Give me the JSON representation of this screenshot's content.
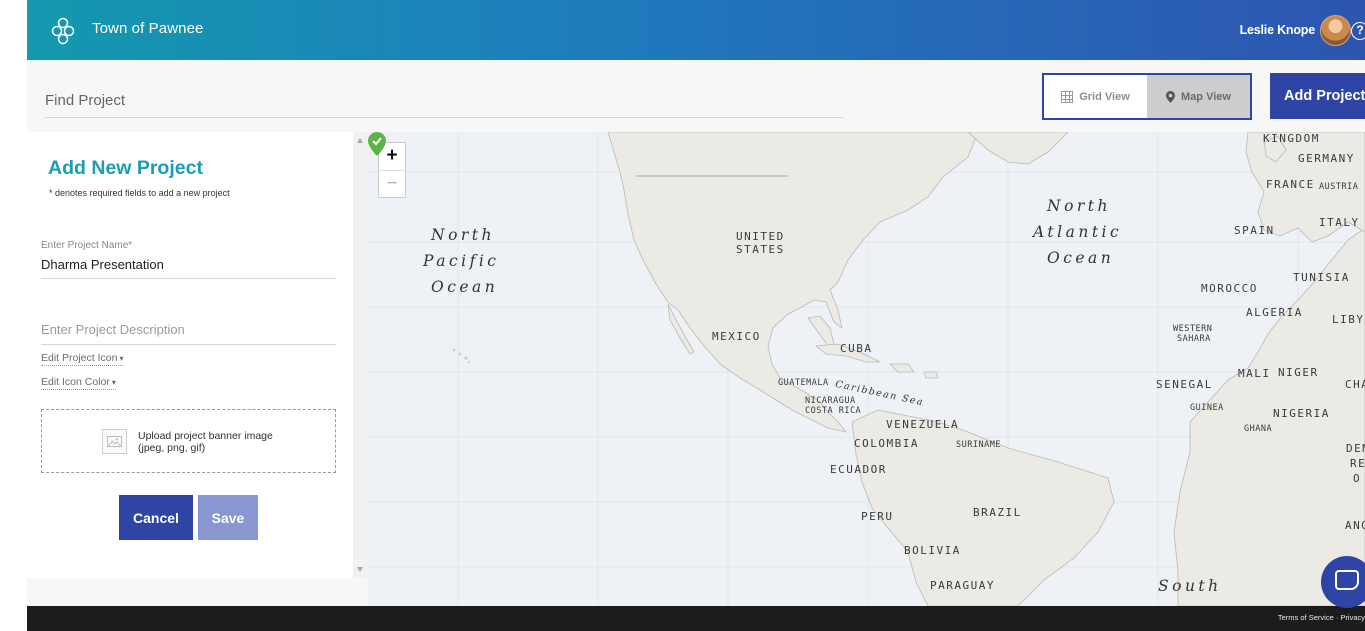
{
  "header": {
    "app_title": "Town of Pawnee",
    "user_name": "Leslie Knope",
    "help_symbol": "?"
  },
  "toolbar": {
    "search_placeholder": "Find Project",
    "grid_view_label": "Grid View",
    "map_view_label": "Map View",
    "active_view": "Map View",
    "add_project_label": "Add Project"
  },
  "panel": {
    "title": "Add New Project",
    "required_note": "* denotes required fields to add a new project",
    "name_label": "Enter Project Name*",
    "name_value": "Dharma Presentation",
    "description_placeholder": "Enter Project Description",
    "edit_icon_label": "Edit Project Icon",
    "edit_color_label": "Edit Icon Color",
    "upload_line1": "Upload project banner image",
    "upload_line2": "(jpeg, png, gif)",
    "cancel_label": "Cancel",
    "save_label": "Save"
  },
  "map": {
    "zoom_in": "+",
    "zoom_out": "−",
    "ocean_labels": {
      "north_pacific": [
        "North",
        "Pacific",
        "Ocean"
      ],
      "north_atlantic": [
        "North",
        "Atlantic",
        "Ocean"
      ],
      "south": "South",
      "caribbean": "Caribbean Sea"
    },
    "country_labels": {
      "united_states_1": "UNITED",
      "united_states_2": "STATES",
      "mexico": "MEXICO",
      "cuba": "CUBA",
      "guatemala": "GUATEMALA",
      "nicaragua": "NICARAGUA",
      "costa_rica": "COSTA RICA",
      "venezuela": "VENEZUELA",
      "colombia": "COLOMBIA",
      "suriname": "SURINAME",
      "ecuador": "ECUADOR",
      "peru": "PERU",
      "brazil": "BRAZIL",
      "bolivia": "BOLIVIA",
      "paraguay": "PARAGUAY",
      "united_kingdom": "KINGDOM",
      "germany": "GERMANY",
      "france": "FRANCE",
      "austria": "AUSTRIA",
      "spain": "SPAIN",
      "italy": "ITALY",
      "tunisia": "TUNISIA",
      "morocco": "MOROCCO",
      "algeria": "ALGERIA",
      "libya": "LIBY",
      "western_sahara_1": "WESTERN",
      "western_sahara_2": "SAHARA",
      "mali": "MALI",
      "niger": "NIGER",
      "chad": "CHA",
      "senegal": "SENEGAL",
      "guinea": "GUINEA",
      "ghana": "GHANA",
      "nigeria": "NIGERIA",
      "angola": "ANGO",
      "dem_rep": "DEM.",
      "rep": "RE",
      "co": "O"
    },
    "marker_color": "#5cb346"
  },
  "footer": {
    "links": "Terms of Service · Privacy"
  },
  "colors": {
    "brand_blue": "#2f45a6",
    "teal_title": "#1a9db7",
    "save_disabled": "#8a96d0"
  },
  "icons": [
    "logo-icon",
    "help-icon",
    "grid-icon",
    "map-pin-icon",
    "image-icon",
    "caret-down-icon",
    "chat-icon",
    "map-marker-icon"
  ]
}
